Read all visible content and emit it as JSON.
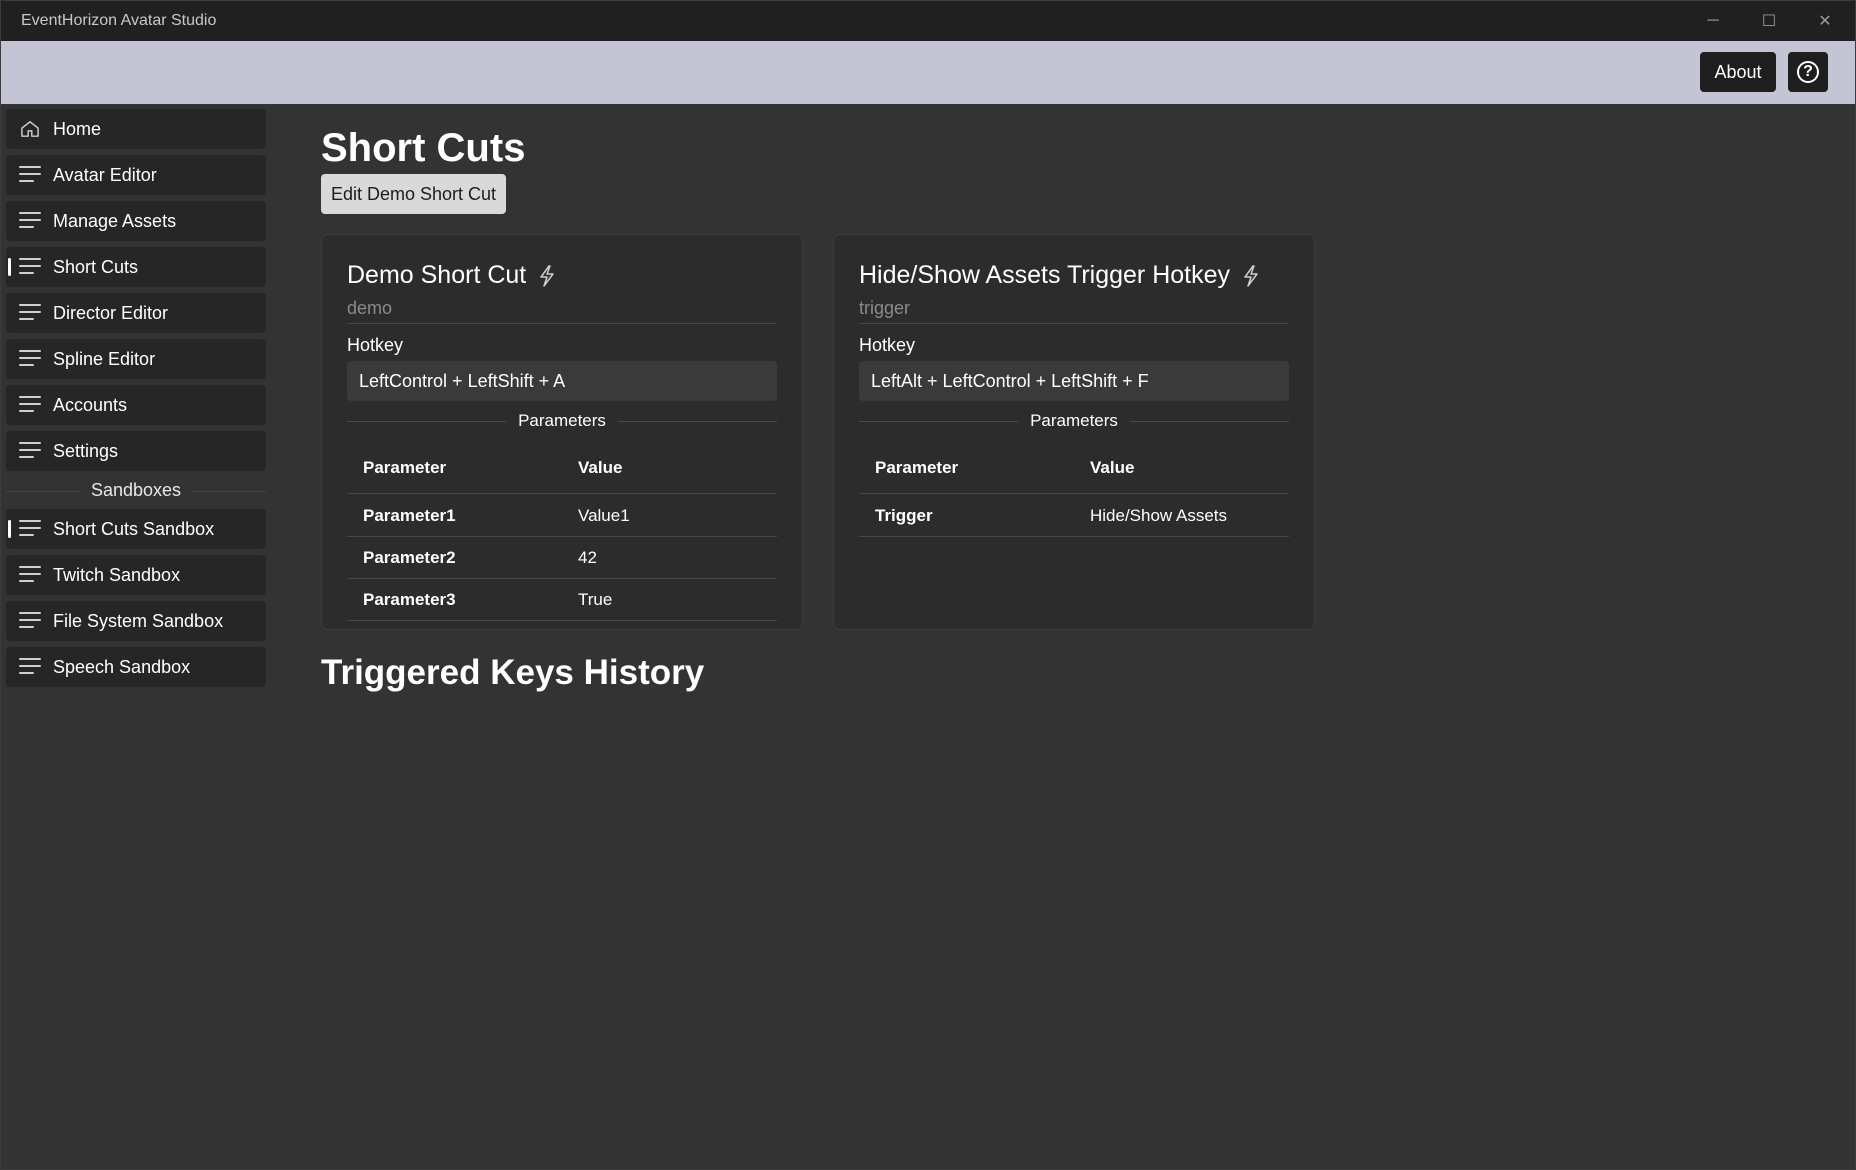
{
  "window": {
    "title": "EventHorizon Avatar Studio",
    "controls": {
      "minimize": "─",
      "maximize": "☐",
      "close": "✕"
    }
  },
  "appbar": {
    "about_label": "About",
    "help_glyph": "?"
  },
  "nav": {
    "items": [
      {
        "label": "Home",
        "icon": "home-icon",
        "selected": false
      },
      {
        "label": "Avatar Editor",
        "icon": "menu-icon",
        "selected": false
      },
      {
        "label": "Manage Assets",
        "icon": "menu-icon",
        "selected": false
      },
      {
        "label": "Short Cuts",
        "icon": "menu-icon",
        "selected": true
      },
      {
        "label": "Director Editor",
        "icon": "menu-icon",
        "selected": false
      },
      {
        "label": "Spline Editor",
        "icon": "menu-icon",
        "selected": false
      },
      {
        "label": "Accounts",
        "icon": "menu-icon",
        "selected": false
      },
      {
        "label": "Settings",
        "icon": "menu-icon",
        "selected": false
      }
    ],
    "section_label": "Sandboxes",
    "sandbox_items": [
      {
        "label": "Short Cuts Sandbox",
        "icon": "menu-icon",
        "selected": true
      },
      {
        "label": "Twitch Sandbox",
        "icon": "menu-icon",
        "selected": false
      },
      {
        "label": "File System Sandbox",
        "icon": "menu-icon",
        "selected": false
      },
      {
        "label": "Speech Sandbox",
        "icon": "menu-icon",
        "selected": false
      }
    ]
  },
  "main": {
    "title": "Short Cuts",
    "edit_button": "Edit Demo Short Cut",
    "cards": [
      {
        "title": "Demo Short Cut",
        "subtitle": "demo",
        "hotkey_label": "Hotkey",
        "hotkey": "LeftControl + LeftShift + A",
        "params_label": "Parameters",
        "columns": [
          "Parameter",
          "Value"
        ],
        "rows": [
          [
            "Parameter1",
            "Value1"
          ],
          [
            "Parameter2",
            "42"
          ],
          [
            "Parameter3",
            "True"
          ]
        ]
      },
      {
        "title": "Hide/Show Assets Trigger Hotkey",
        "subtitle": "trigger",
        "hotkey_label": "Hotkey",
        "hotkey": "LeftAlt + LeftControl + LeftShift + F",
        "params_label": "Parameters",
        "columns": [
          "Parameter",
          "Value"
        ],
        "rows": [
          [
            "Trigger",
            "Hide/Show Assets"
          ]
        ]
      }
    ],
    "history_title": "Triggered Keys History"
  },
  "colors": {
    "background": "#333333",
    "appbar": "#c4c5d4",
    "nav_item": "#262626",
    "card": "#2c2c2c"
  }
}
